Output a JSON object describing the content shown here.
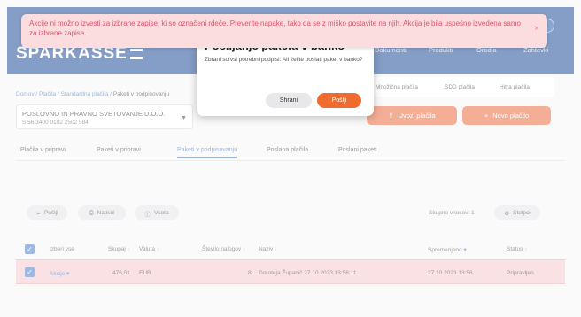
{
  "header": {
    "logo": "SPARKASSE",
    "nav": [
      "Dokumenti",
      "Produkti",
      "Orodja",
      "Zahtevki"
    ],
    "subnav": [
      "Množična plačila",
      "SDD plačila",
      "Hitra plačila"
    ]
  },
  "breadcrumb": [
    "Domov",
    "Plačila",
    "Standardna plačila",
    "Paketi v podpisovanju"
  ],
  "account": {
    "name": "POSLOVNO IN PRAVNO SVETOVANJE D.O.O.",
    "iban": "SI56 3400 0102 2502 584"
  },
  "actions": {
    "import": "Uvozi plačila",
    "new_payment": "Novo plačilo"
  },
  "tabs": [
    "Plačila v pripravi",
    "Paketi v pripravi",
    "Paketi v podpisovanju",
    "Poslana plačila",
    "Poslani paketi"
  ],
  "toolbar": {
    "send": "Pošlji",
    "print": "Natisni",
    "total_row": "Vsota",
    "count": "Skupno vnosov: 1",
    "columns": "Stolpci"
  },
  "table": {
    "headers": [
      "Izberi vse",
      "Skupaj",
      "Valuta",
      "Število nalogov",
      "Naziv",
      "Spremenjeno",
      "Status"
    ],
    "rows": [
      {
        "action": "Akcije",
        "total": "476,01",
        "currency": "EUR",
        "count": "8",
        "name": "Doroteja Županič 27.10.2023 13:56:11",
        "modified": "27.10.2023 13:56",
        "status": "Pripravljen"
      }
    ]
  },
  "modal": {
    "title": "Pošiljanje paketa v banko",
    "text": "Zbrani so vsi potrebni podpisi. Ali želite poslati paket v banko?",
    "save": "Shrani",
    "send": "Pošlji"
  },
  "toast": {
    "message": "Akcije ni možno izvesti za izbrane zapise, ki so označeni rdeče. Preverite napake, tako da se z miško postavite na njih. Akcija je bila uspešno izvedena samo za izbrane zapise."
  }
}
